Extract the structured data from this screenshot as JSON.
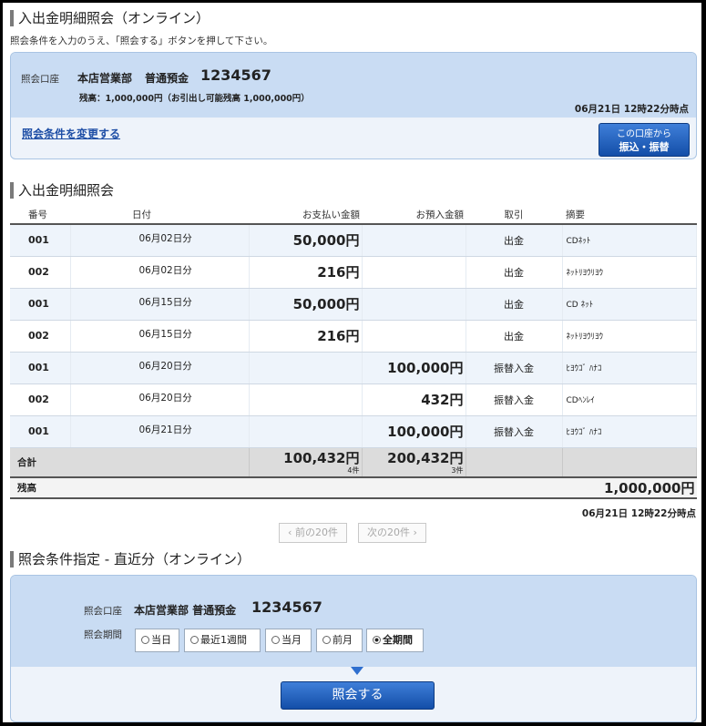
{
  "header": {
    "title": "入出金明細照会（オンライン）",
    "instruction": "照会条件を入力のうえ、「照会する」ボタンを押して下さい。"
  },
  "account": {
    "label": "照会口座",
    "branch": "本店営業部",
    "type": "普通預金",
    "number": "1234567",
    "balance_line": "残高：1,000,000円（お引出し可能残高 1,000,000円）",
    "as_of": "06月21日 12時22分時点",
    "change_link": "照会条件を変更する",
    "transfer_button_line1": "この口座から",
    "transfer_button_line2": "振込・振替"
  },
  "detail": {
    "title": "入出金明細照会",
    "columns": [
      "番号",
      "日付",
      "お支払い金額",
      "お預入金額",
      "取引",
      "摘要"
    ],
    "rows": [
      {
        "no": "001",
        "date": "06月02日分",
        "pay": "50,000円",
        "deposit": "",
        "kind": "出金",
        "memo": "CDﾈｯﾄ"
      },
      {
        "no": "002",
        "date": "06月02日分",
        "pay": "216円",
        "deposit": "",
        "kind": "出金",
        "memo": "ﾈｯﾄﾘﾖｳﾘﾖｳ"
      },
      {
        "no": "001",
        "date": "06月15日分",
        "pay": "50,000円",
        "deposit": "",
        "kind": "出金",
        "memo": "CD ﾈｯﾄ"
      },
      {
        "no": "002",
        "date": "06月15日分",
        "pay": "216円",
        "deposit": "",
        "kind": "出金",
        "memo": "ﾈｯﾄﾘﾖｳﾘﾖｳ"
      },
      {
        "no": "001",
        "date": "06月20日分",
        "pay": "",
        "deposit": "100,000円",
        "kind": "振替入金",
        "memo": "ﾋﾖｳｺﾞ ﾊﾅｺ"
      },
      {
        "no": "002",
        "date": "06月20日分",
        "pay": "",
        "deposit": "432円",
        "kind": "振替入金",
        "memo": "CDﾍﾝﾚｲ"
      },
      {
        "no": "001",
        "date": "06月21日分",
        "pay": "",
        "deposit": "100,000円",
        "kind": "振替入金",
        "memo": "ﾋﾖｳｺﾞ ﾊﾅｺ"
      }
    ],
    "total_label": "合計",
    "total_pay": "100,432円",
    "total_pay_count": "4件",
    "total_deposit": "200,432円",
    "total_deposit_count": "3件",
    "balance_label": "残高",
    "balance_value": "1,000,000円",
    "as_of": "06月21日 12時22分時点",
    "prev_page": "前の20件",
    "next_page": "次の20件"
  },
  "condition": {
    "title": "照会条件指定 - 直近分（オンライン）",
    "account_label": "照会口座",
    "account_value": "本店営業部 普通預金",
    "account_number": "1234567",
    "period_label": "照会期間",
    "periods": [
      "当日",
      "最近1週間",
      "当月",
      "前月",
      "全期間"
    ],
    "selected_period": "全期間",
    "submit_label": "照会する"
  }
}
